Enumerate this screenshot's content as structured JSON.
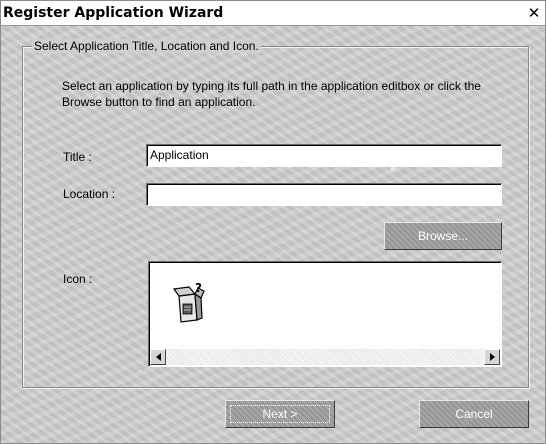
{
  "window": {
    "title": "Register Application Wizard",
    "close_glyph": "✕"
  },
  "group": {
    "legend": "Select Application Title, Location and Icon."
  },
  "instructions": "Select an application by typing its full path in the application editbox or click the Browse button to find an application.",
  "form": {
    "title_label": "Title :",
    "title_value": "Application",
    "location_label": "Location :",
    "location_value": "",
    "icon_label": "Icon :",
    "browse_label": "Browse..."
  },
  "footer": {
    "next_label": "Next >",
    "cancel_label": "Cancel"
  },
  "icons": {
    "app_icon": "application-package-icon",
    "scroll_left": "scroll-left-arrow-icon",
    "scroll_right": "scroll-right-arrow-icon"
  },
  "colors": {
    "button_face": "#9d9d9d",
    "window_background": "#cfcfcf"
  }
}
